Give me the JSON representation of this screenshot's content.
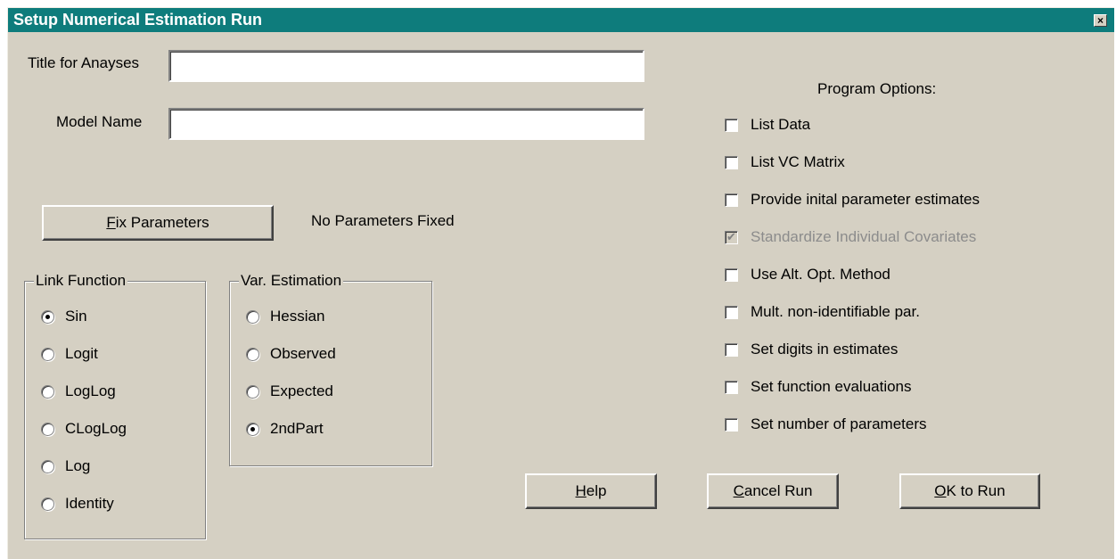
{
  "window": {
    "title": "Setup Numerical Estimation Run",
    "close_glyph": "×"
  },
  "fields": {
    "title_label": "Title for Anayses",
    "title_value": "",
    "model_label": "Model Name",
    "model_value": ""
  },
  "fix_parameters": {
    "button_accel": "F",
    "button_rest": "ix Parameters",
    "status": "No Parameters Fixed"
  },
  "link_function": {
    "title": "Link Function",
    "options": [
      "Sin",
      "Logit",
      "LogLog",
      "CLogLog",
      "Log",
      "Identity"
    ],
    "selected": "Sin"
  },
  "var_estimation": {
    "title": "Var. Estimation",
    "options": [
      "Hessian",
      "Observed",
      "Expected",
      "2ndPart"
    ],
    "selected": "2ndPart"
  },
  "program_options": {
    "title": "Program Options:",
    "items": [
      {
        "label": "List Data",
        "checked": false,
        "disabled": false
      },
      {
        "label": "List VC Matrix",
        "checked": false,
        "disabled": false
      },
      {
        "label": "Provide inital parameter estimates",
        "checked": false,
        "disabled": false
      },
      {
        "label": "Standardize Individual Covariates",
        "checked": true,
        "disabled": true
      },
      {
        "label": "Use Alt. Opt. Method",
        "checked": false,
        "disabled": false
      },
      {
        "label": "Mult. non-identifiable par.",
        "checked": false,
        "disabled": false
      },
      {
        "label": "Set digits in estimates",
        "checked": false,
        "disabled": false
      },
      {
        "label": "Set function evaluations",
        "checked": false,
        "disabled": false
      },
      {
        "label": "Set number of parameters",
        "checked": false,
        "disabled": false
      }
    ]
  },
  "buttons": {
    "help_accel": "H",
    "help_rest": "elp",
    "cancel_accel": "C",
    "cancel_rest": "ancel Run",
    "ok_accel": "O",
    "ok_rest": "K to Run"
  },
  "colors": {
    "titlebar": "#0e7c7c",
    "face": "#d5d0c3"
  }
}
